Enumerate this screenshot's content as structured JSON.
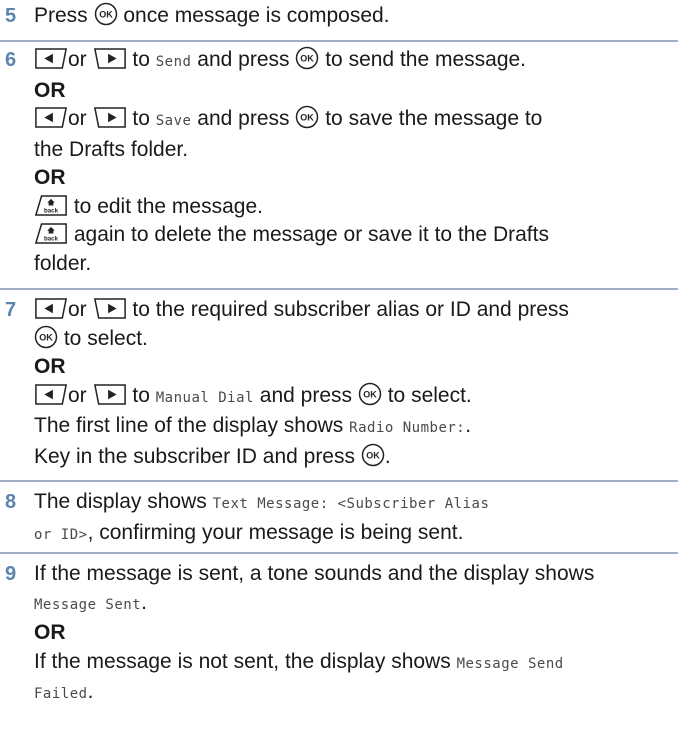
{
  "steps": [
    {
      "num": "5",
      "a": "Press",
      "b": "once message is composed."
    },
    {
      "num": "6",
      "l1_or": "or",
      "l1_to": "to",
      "l1_mono": "Send",
      "l1_press": "and press",
      "l1_end": "to send the message.",
      "or1": "OR",
      "l2_or": "or",
      "l2_to": "to",
      "l2_mono": "Save",
      "l2_press": "and press",
      "l2_end": "to save the message to",
      "l3": "the Drafts folder.",
      "or2": "OR",
      "l4": "to edit the message.",
      "l5": "again to delete the message or save it to the Drafts",
      "l6": "folder."
    },
    {
      "num": "7",
      "l1_or": "or",
      "l1_end": "to the required subscriber alias or ID and press",
      "l2": "to select.",
      "or1": "OR",
      "l3_or": "or",
      "l3_to": "to",
      "l3_mono": "Manual Dial",
      "l3_press": "and press",
      "l3_end": "to select.",
      "l4_a": "The first line of the display shows",
      "l4_mono": "Radio Number:",
      "l4_dot": ".",
      "l5": "Key in the subscriber ID and press",
      "l5_dot": "."
    },
    {
      "num": "8",
      "l1_a": "The display shows",
      "l1_mono": "Text Message: <Subscriber Alias",
      "l2_mono": "or ID>",
      "l2_end": ", confirming your message is being sent."
    },
    {
      "num": "9",
      "l1": "If the message is sent, a tone sounds and the display shows",
      "l2_mono": "Message Sent",
      "l2_dot": ".",
      "or1": "OR",
      "l3_a": "If the message is not sent, the display shows",
      "l3_mono": "Message Send",
      "l4_mono": "Failed",
      "l4_dot": "."
    }
  ],
  "icons": {
    "ok": "ok-button-icon",
    "left": "left-nav-key-icon",
    "right": "right-nav-key-icon",
    "back": "back-home-key-icon"
  },
  "colors": {
    "step_number": "#5b84b0",
    "rule": "#9fb0c4"
  }
}
